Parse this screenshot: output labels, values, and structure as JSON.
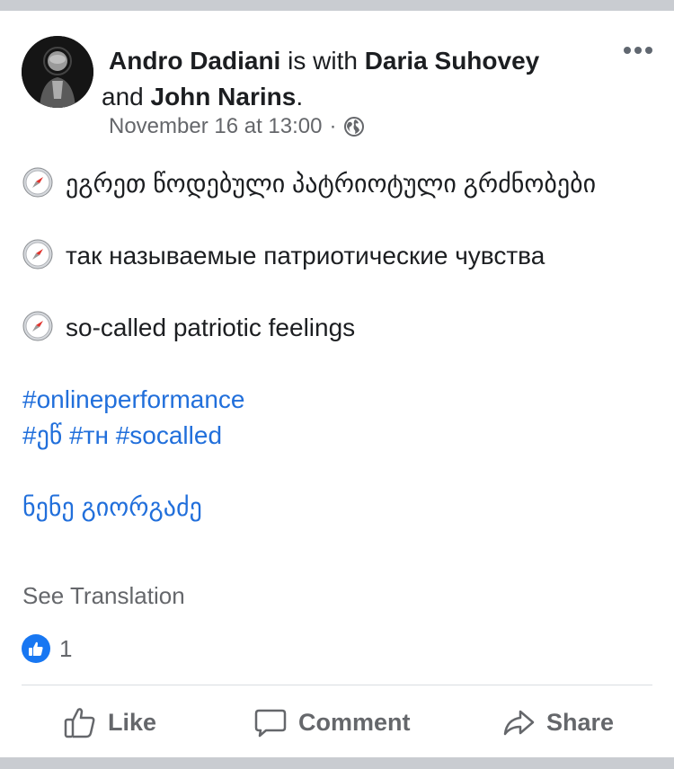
{
  "post": {
    "author": "Andro Dadiani",
    "with_text": " is with ",
    "tagged_1": "Daria  Suhovey",
    "and_text": " and ",
    "tagged_2": "John Narins",
    "period": ".",
    "timestamp": "November 16 at 13:00",
    "separator": "·",
    "privacy_icon": "globe-icon",
    "body": {
      "line_georgian": "ეგრეთ წოდებული პატრიოტული გრძნობები",
      "line_russian": "так называемые патриотические чувства",
      "line_english": "so-called patriotic feelings",
      "line_icon": "compass-icon",
      "hashtag_1": "#onlineperformance",
      "hashtag_2": "#ეწ",
      "hashtag_3": "#тн",
      "hashtag_4": "#socalled",
      "mention": "ნენე გიორგაძე"
    },
    "see_translation": "See Translation",
    "reaction_count": "1"
  },
  "actions": {
    "like": "Like",
    "comment": "Comment",
    "share": "Share"
  },
  "colors": {
    "link": "#216fdb",
    "secondary_text": "#65676b",
    "like_blue": "#1877f2",
    "frame_gray": "#c9ccd1"
  }
}
